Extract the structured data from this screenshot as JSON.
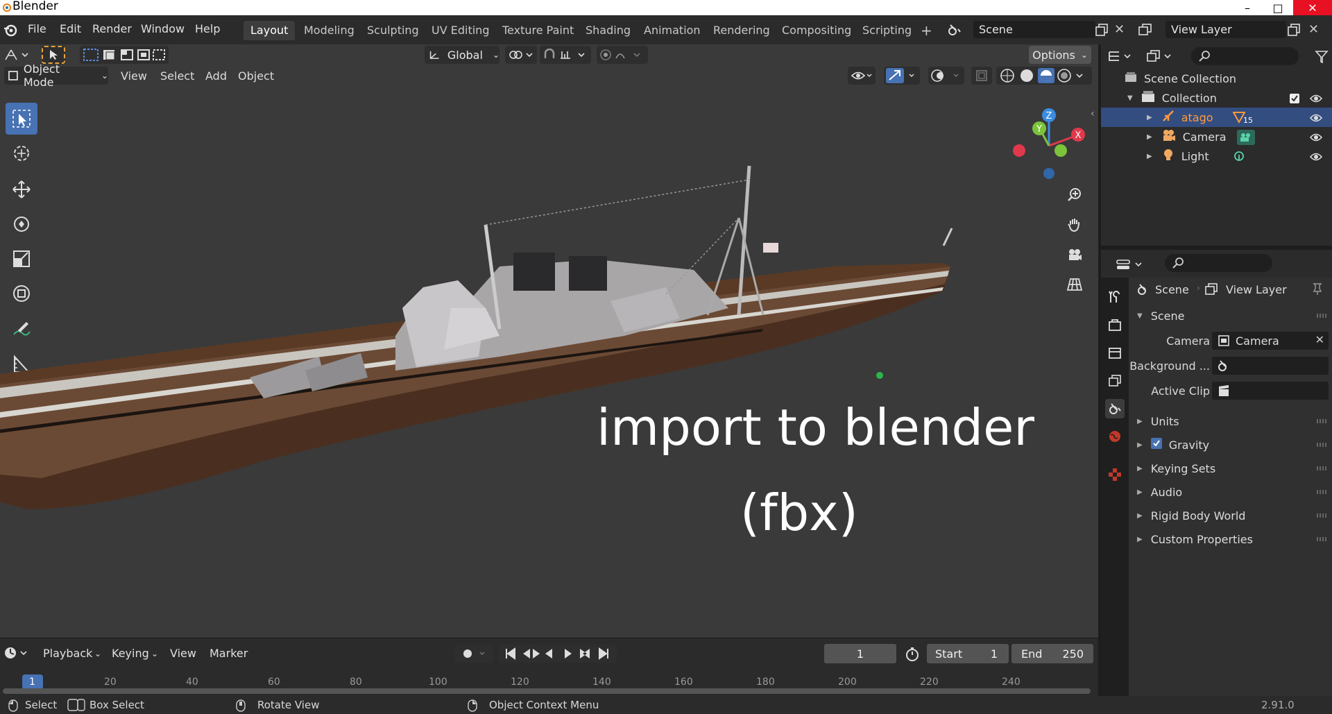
{
  "window": {
    "title": "Blender",
    "min": "–",
    "max": "□",
    "close": "✕"
  },
  "menu": [
    "File",
    "Edit",
    "Render",
    "Window",
    "Help"
  ],
  "workspaces": [
    "Layout",
    "Modeling",
    "Sculpting",
    "UV Editing",
    "Texture Paint",
    "Shading",
    "Animation",
    "Rendering",
    "Compositing",
    "Scripting"
  ],
  "scene_field": "Scene",
  "viewlayer_field": "View Layer",
  "viewport": {
    "orientation": "Global",
    "options": "Options",
    "mode": "Object Mode",
    "menus": [
      "View",
      "Select",
      "Add",
      "Object"
    ],
    "overlay_title": "import to blender",
    "overlay_subtitle": "(fbx)",
    "axes": {
      "x": "X",
      "y": "Y",
      "z": "Z"
    }
  },
  "timeline": {
    "menus": [
      "Playback",
      "Keying",
      "View",
      "Marker"
    ],
    "current_frame": "1",
    "start_label": "Start",
    "start_value": "1",
    "end_label": "End",
    "end_value": "250",
    "ruler": [
      "1",
      "20",
      "40",
      "60",
      "80",
      "100",
      "120",
      "140",
      "160",
      "180",
      "200",
      "220",
      "240"
    ]
  },
  "statusbar": {
    "select": "Select",
    "box_select": "Box Select",
    "rotate_view": "Rotate View",
    "context_menu": "Object Context Menu",
    "version": "2.91.0"
  },
  "outliner": {
    "scene_collection": "Scene Collection",
    "collection": "Collection",
    "items": [
      {
        "name": "atago",
        "badge": "15"
      },
      {
        "name": "Camera"
      },
      {
        "name": "Light"
      }
    ]
  },
  "properties": {
    "breadcrumb_scene": "Scene",
    "breadcrumb_viewlayer": "View Layer",
    "panel_scene": "Scene",
    "camera_label": "Camera",
    "camera_value": "Camera",
    "background_label": "Background ...",
    "active_clip_label": "Active Clip",
    "panels": [
      "Units",
      "Gravity",
      "Keying Sets",
      "Audio",
      "Rigid Body World",
      "Custom Properties"
    ]
  },
  "colors": {
    "accent": "#4772b3",
    "selected_row": "#334d80",
    "atago_text": "#ff9a3c",
    "axis_x": "#e0394b",
    "axis_y": "#7cc33c",
    "axis_z": "#3a8de0"
  }
}
